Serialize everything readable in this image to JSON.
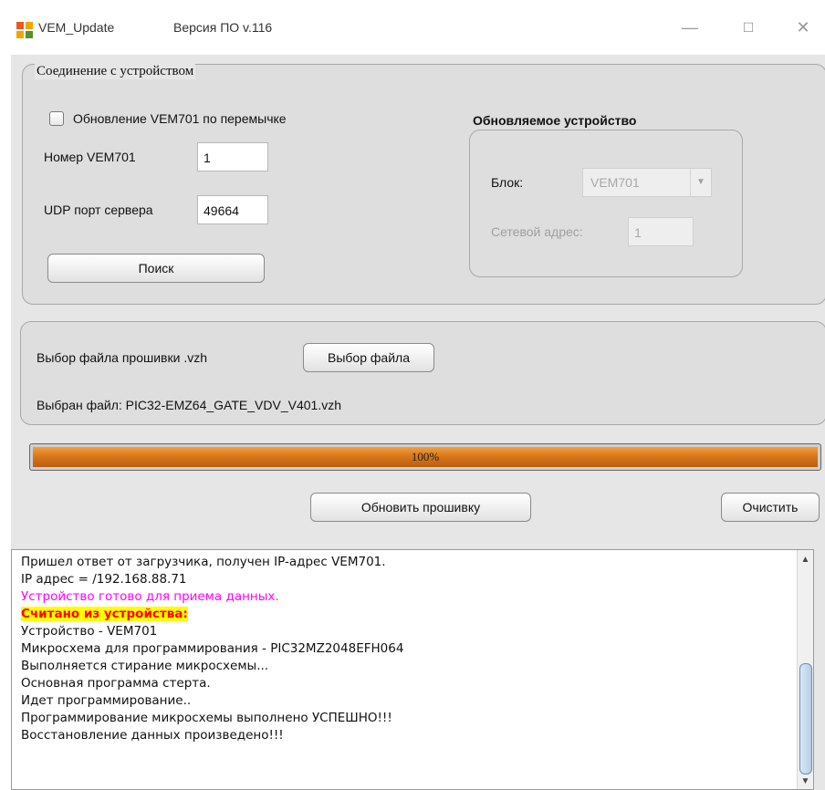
{
  "titlebar": {
    "app_name": "VEM_Update",
    "version": "Версия ПО v.116",
    "minimize": "—",
    "maximize": "☐",
    "close": "✕"
  },
  "connection": {
    "legend": "Соединение с устройством",
    "checkbox_label": "Обновление VEM701 по перемычке",
    "checkbox_checked": false,
    "number_label": "Номер VEM701",
    "number_value": "1",
    "udp_label": "UDP порт сервера",
    "udp_value": "49664",
    "search_button": "Поиск"
  },
  "device": {
    "title": "Обновляемое устройство",
    "block_label": "Блок:",
    "block_value": "VEM701",
    "address_label": "Сетевой адрес:",
    "address_value": "1"
  },
  "file": {
    "select_label": "Выбор файла прошивки .vzh",
    "select_button": "Выбор файла",
    "selected_text": "Выбран файл: PIC32-EMZ64_GATE_VDV_V401.vzh"
  },
  "progress": {
    "percent": 100,
    "label": "100%"
  },
  "actions": {
    "update_button": "Обновить прошивку",
    "clear_button": "Очистить"
  },
  "log": {
    "lines": [
      {
        "text": "Пришел ответ от загрузчика, получен IP-адрес VEM701.",
        "style": "normal"
      },
      {
        "text": "IP адрес = /192.168.88.71",
        "style": "normal"
      },
      {
        "text": "Устройство готово для приема данных.",
        "style": "magenta"
      },
      {
        "text": "Считано из устройства:",
        "style": "highlight"
      },
      {
        "text": "Устройство - VEM701",
        "style": "normal"
      },
      {
        "text": "Микросхема для программирования - PIC32MZ2048EFH064",
        "style": "normal"
      },
      {
        "text": "Выполняется стирание микросхемы...",
        "style": "normal"
      },
      {
        "text": "Основная программа стерта.",
        "style": "normal"
      },
      {
        "text": "Идет программирование..",
        "style": "normal"
      },
      {
        "text": "Программирование микросхемы выполнено УСПЕШНО!!!",
        "style": "normal"
      },
      {
        "text": "Восстановление данных произведено!!!",
        "style": "normal"
      }
    ],
    "scroll_up": "▲",
    "scroll_down": "▼"
  }
}
